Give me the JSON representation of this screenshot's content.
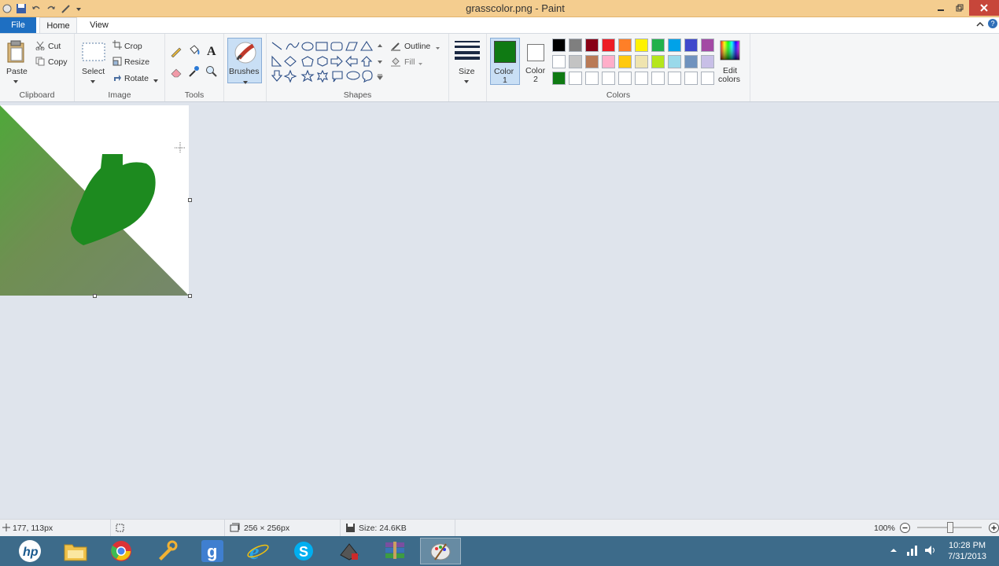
{
  "window": {
    "title": "grasscolor.png - Paint"
  },
  "menu": {
    "file": "File",
    "tabs": [
      "Home",
      "View"
    ]
  },
  "ribbon": {
    "clipboard": {
      "label": "Clipboard",
      "paste": "Paste",
      "cut": "Cut",
      "copy": "Copy"
    },
    "image": {
      "label": "Image",
      "select": "Select",
      "crop": "Crop",
      "resize": "Resize",
      "rotate": "Rotate"
    },
    "tools": {
      "label": "Tools"
    },
    "brushes": {
      "label": "Brushes"
    },
    "shapes": {
      "label": "Shapes",
      "outline": "Outline",
      "fill": "Fill"
    },
    "size": {
      "label": "Size"
    },
    "colors": {
      "label": "Colors",
      "color1_line1": "Color",
      "color1_line2": "1",
      "color2_line1": "Color",
      "color2_line2": "2",
      "edit_line1": "Edit",
      "edit_line2": "colors",
      "color1": "#0f7a13",
      "color2": "#ffffff",
      "palette_row1": [
        "#000000",
        "#7f7f7f",
        "#880015",
        "#ed1c24",
        "#ff7f27",
        "#fff200",
        "#22b14c",
        "#00a2e8",
        "#3f48cc",
        "#a349a4"
      ],
      "palette_row2": [
        "#ffffff",
        "#c3c3c3",
        "#b97a57",
        "#ffaec9",
        "#ffc90e",
        "#efe4b0",
        "#b5e61d",
        "#99d9ea",
        "#7092be",
        "#c8bfe7"
      ],
      "palette_row3": [
        "#0f7a13",
        "#ffffff",
        "#ffffff",
        "#ffffff",
        "#ffffff",
        "#ffffff",
        "#ffffff",
        "#ffffff",
        "#ffffff",
        "#ffffff"
      ]
    }
  },
  "status": {
    "cursor": "177, 113px",
    "dimensions": "256 × 256px",
    "size": "Size: 24.6KB",
    "zoom": "100%"
  },
  "taskbar": {
    "apps": [
      "hp-icon",
      "file-explorer-icon",
      "chrome-icon",
      "tools-app-icon",
      "g-app-icon",
      "internet-explorer-icon",
      "skype-icon",
      "game-app-icon",
      "archive-app-icon",
      "paint-icon"
    ],
    "time": "10:28 PM",
    "date": "7/31/2013"
  }
}
